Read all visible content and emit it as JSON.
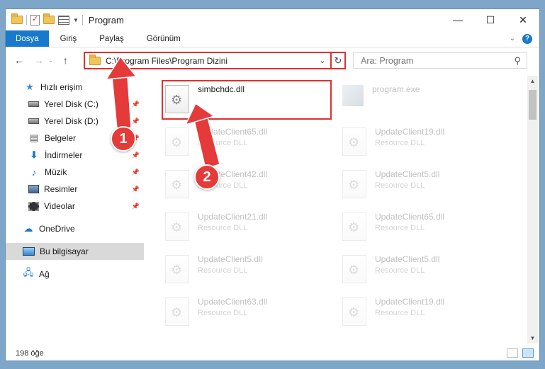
{
  "window": {
    "title": "Program"
  },
  "ribbon": {
    "tabs": [
      "Dosya",
      "Giriş",
      "Paylaş",
      "Görünüm"
    ],
    "help": "?"
  },
  "address": {
    "path": "C:\\Program Files\\Program Dizini"
  },
  "search": {
    "placeholder": "Ara: Program"
  },
  "sidebar": {
    "items": [
      {
        "label": "Hızlı erişim"
      },
      {
        "label": "Yerel Disk (C:)"
      },
      {
        "label": "Yerel Disk (D:)"
      },
      {
        "label": "Belgeler"
      },
      {
        "label": "İndirmeler"
      },
      {
        "label": "Müzik"
      },
      {
        "label": "Resimler"
      },
      {
        "label": "Videolar"
      },
      {
        "label": "OneDrive"
      },
      {
        "label": "Bu bilgisayar"
      },
      {
        "label": "Ağ"
      }
    ]
  },
  "files": [
    {
      "name": "simbchdc.dll",
      "type": ""
    },
    {
      "name": "program.exe",
      "type": ""
    },
    {
      "name": "UpdateClient65.dll",
      "type": "Resource DLL"
    },
    {
      "name": "UpdateClient19.dll",
      "type": "Resource DLL"
    },
    {
      "name": "UpdateClient42.dll",
      "type": "Resource DLL"
    },
    {
      "name": "UpdateClient5.dll",
      "type": "Resource DLL"
    },
    {
      "name": "UpdateClient21.dll",
      "type": "Resource DLL"
    },
    {
      "name": "UpdateClient65.dll",
      "type": "Resource DLL"
    },
    {
      "name": "UpdateClient5.dll",
      "type": "Resource DLL"
    },
    {
      "name": "UpdateClient5.dll",
      "type": "Resource DLL"
    },
    {
      "name": "UpdateClient63.dll",
      "type": "Resource DLL"
    },
    {
      "name": "UpdateClient19.dll",
      "type": "Resource DLL"
    }
  ],
  "status": {
    "count": "198 öğe"
  },
  "annotations": {
    "step1": "1",
    "step2": "2",
    "color": "#e03030"
  }
}
